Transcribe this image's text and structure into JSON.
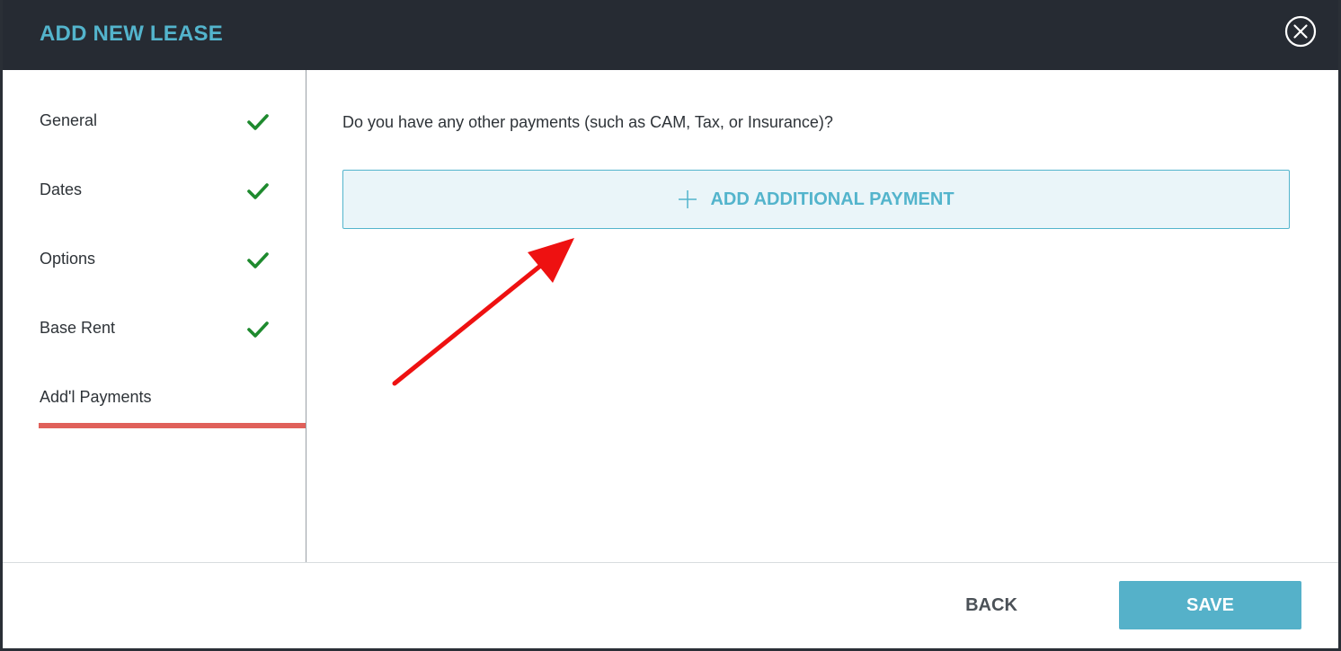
{
  "modal": {
    "title": "ADD NEW LEASE",
    "close_icon": "close-circle-icon"
  },
  "sidebar": {
    "items": [
      {
        "label": "General",
        "completed": true,
        "icon": "check-icon"
      },
      {
        "label": "Dates",
        "completed": true,
        "icon": "check-icon"
      },
      {
        "label": "Options",
        "completed": true,
        "icon": "check-icon"
      },
      {
        "label": "Base Rent",
        "completed": true,
        "icon": "check-icon"
      },
      {
        "label": "Add'l Payments",
        "completed": false,
        "active": true
      }
    ]
  },
  "main": {
    "question": "Do you have any other payments (such as CAM, Tax, or Insurance)?",
    "add_button_label": "ADD ADDITIONAL PAYMENT",
    "add_button_icon": "plus-icon",
    "annotation": "red-arrow-icon"
  },
  "footer": {
    "back_label": "BACK",
    "save_label": "SAVE"
  },
  "colors": {
    "header_bg": "#262b33",
    "accent": "#53b4cc",
    "check": "#1e8a2e",
    "active_underline": "#e0605a",
    "annotation_arrow": "#ee1111"
  }
}
